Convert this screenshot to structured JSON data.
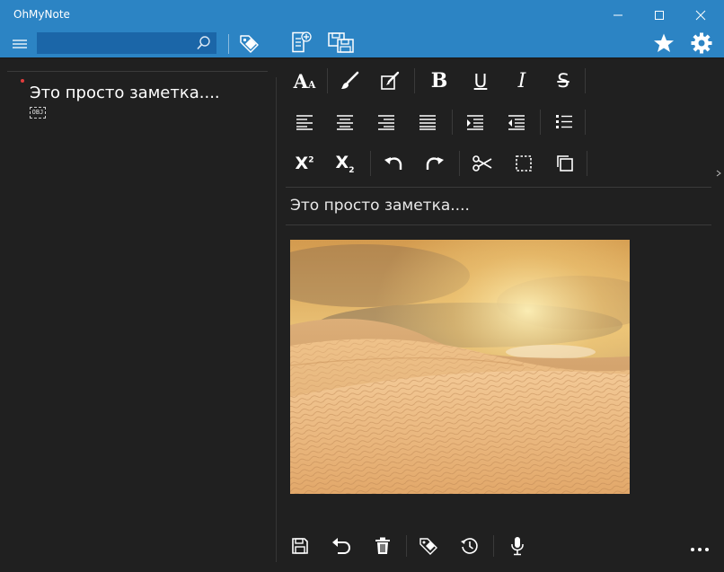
{
  "app": {
    "title": "OhMyNote"
  },
  "search": {
    "placeholder": "",
    "value": ""
  },
  "notes": [
    {
      "title": "Это просто заметка....",
      "badge": "OBJ"
    }
  ],
  "editor": {
    "text": "Это просто заметка....",
    "image": {
      "description": "desert-dunes",
      "watermark": ""
    }
  },
  "format_toolbar": {
    "font_size_label": "A",
    "font_size_small": "A",
    "bold_label": "B",
    "underline_label": "U",
    "italic_label": "I",
    "strike_label": "S",
    "superscript_label": "X",
    "superscript_mark": "2",
    "subscript_label": "X",
    "subscript_mark": "2"
  },
  "colors": {
    "title_bar": "#2c84c4",
    "search_bg": "#1b66a8",
    "background": "#202020",
    "accent_dot": "#e23c3c"
  },
  "icons": {
    "toolbar": [
      "hamburger-icon",
      "search-icon",
      "tag-icon",
      "new-note-icon",
      "save-multi-icon",
      "star-icon",
      "gear-icon"
    ],
    "window": [
      "minimize-icon",
      "maximize-icon",
      "close-icon"
    ],
    "bottom": [
      "save-icon",
      "undo-icon",
      "trash-icon",
      "tag-icon",
      "history-icon",
      "microphone-icon",
      "more-icon"
    ]
  }
}
